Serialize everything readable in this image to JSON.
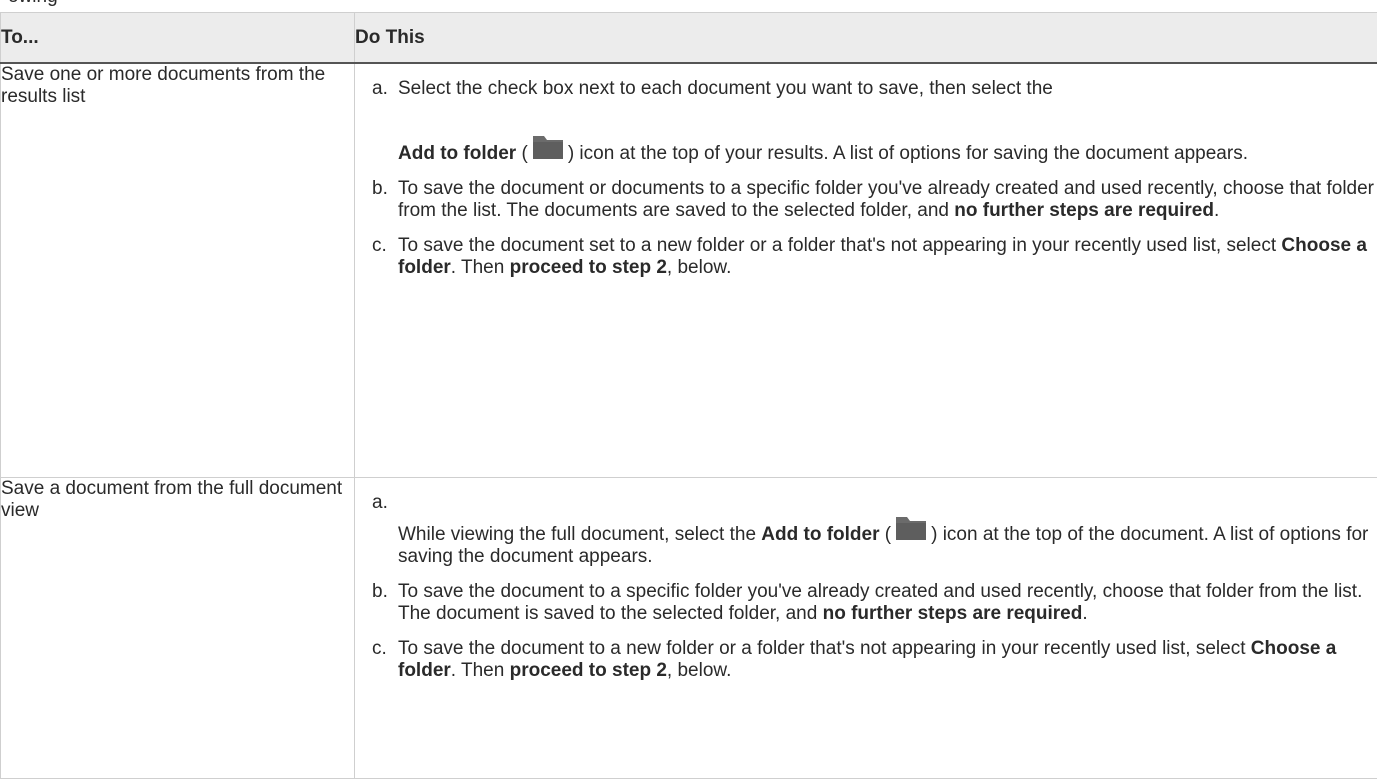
{
  "clipped_text": "owing",
  "table": {
    "headers": {
      "to": "To...",
      "do_this": "Do This"
    },
    "rows": [
      {
        "to": "Save one or more documents from the results list",
        "steps": [
          {
            "marker": "a.",
            "text1": "Select the check box next to each document you want to save, then select the",
            "bold1": "Add to folder",
            "text2": " (",
            "icon": "folder-icon",
            "text3": ") icon at the top of your results. A list of options for saving the document appears."
          },
          {
            "marker": "b.",
            "text1": "To save the document or documents to a specific folder you've already created and used recently, choose that folder from the list. The documents are saved to the selected folder, and ",
            "bold1": "no further steps are required",
            "text2": "."
          },
          {
            "marker": "c.",
            "text1": "To save the document set to a new folder or a folder that's not appearing in your recently used list, select ",
            "bold1": "Choose a folder",
            "text2": ". Then ",
            "bold2": "proceed to step 2",
            "text3": ", below."
          }
        ]
      },
      {
        "to": "Save a document from the full document view",
        "steps": [
          {
            "marker": "a.",
            "text1": "While viewing the full document, select the ",
            "bold1": "Add to folder",
            "text2": " (",
            "icon": "folder-icon",
            "text3": ") icon at the top of the document. A list of options for saving the document appears."
          },
          {
            "marker": "b.",
            "text1": "To save the document to a specific folder you've already created and used recently, choose that folder from the list. The document is saved to the selected folder, and ",
            "bold1": "no further steps are required",
            "text2": "."
          },
          {
            "marker": "c.",
            "text1": "To save the document to a new folder or a folder that's not appearing in your recently used list, select ",
            "bold1": "Choose a folder",
            "text2": ". Then ",
            "bold2": "proceed to step 2",
            "text3": ", below."
          }
        ]
      }
    ]
  },
  "colors": {
    "header_bg": "#ececec",
    "border": "#cfcfcf",
    "icon": "#6b6b6b"
  }
}
